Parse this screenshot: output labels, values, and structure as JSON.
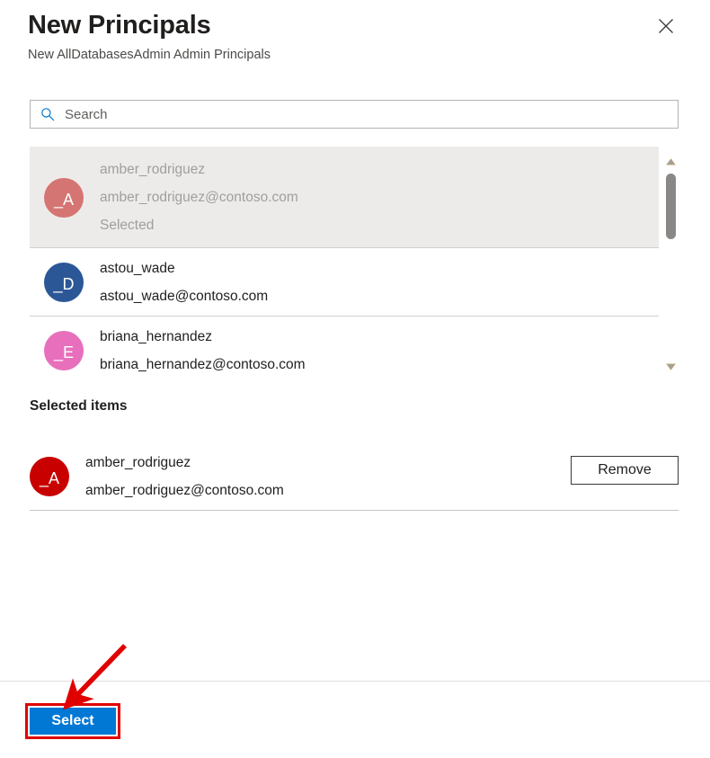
{
  "header": {
    "title": "New Principals",
    "subtitle": "New AllDatabasesAdmin Admin Principals",
    "close_icon": "close-icon"
  },
  "search": {
    "placeholder": "Search",
    "value": "",
    "icon": "search-icon"
  },
  "results": {
    "items": [
      {
        "name": "amber_rodriguez",
        "email": "amber_rodriguez@contoso.com",
        "state": "Selected",
        "initials": "_A",
        "avatar_color": "#d57573",
        "is_selected": true
      },
      {
        "name": "astou_wade",
        "email": "astou_wade@contoso.com",
        "state": "",
        "initials": "_D",
        "avatar_color": "#2b5797",
        "is_selected": false
      },
      {
        "name": "briana_hernandez",
        "email": "briana_hernandez@contoso.com",
        "state": "",
        "initials": "_E",
        "avatar_color": "#e濃"
      }
    ],
    "scrollbar": {
      "up_icon": "chevron-up-icon",
      "down_icon": "chevron-down-icon"
    }
  },
  "selected_section": {
    "heading": "Selected items",
    "item": {
      "name": "amber_rodriguez",
      "email": "amber_rodriguez@contoso.com",
      "initials": "_A",
      "avatar_color": "#c80000"
    },
    "remove_label": "Remove"
  },
  "footer": {
    "select_label": "Select"
  },
  "annotation": {
    "color": "#e00000"
  },
  "colors": {
    "accent": "#0078d4",
    "selected_row_bg": "#edebe9",
    "avatar_pink": "#e86fbc",
    "avatar_blue": "#2b5797",
    "avatar_red_faded": "#d57573",
    "avatar_red": "#c80000"
  }
}
